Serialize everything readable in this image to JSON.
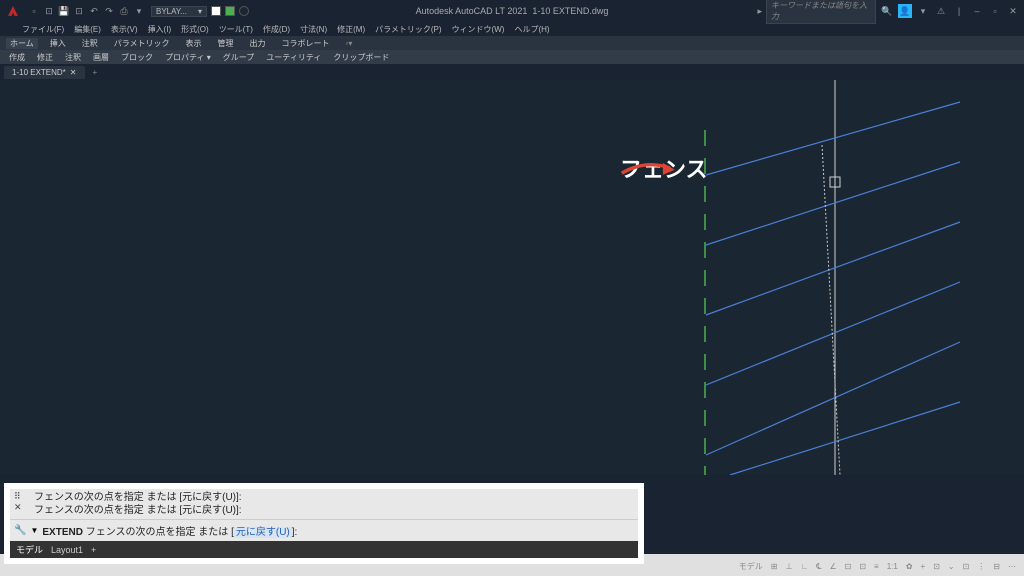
{
  "app": {
    "name": "Autodesk AutoCAD LT 2021",
    "filename": "1-10 EXTEND.dwg",
    "search_placeholder": "キーワードまたは語句を入力",
    "layer_name": "BYLAY..."
  },
  "menus": [
    "ファイル(F)",
    "編集(E)",
    "表示(V)",
    "挿入(I)",
    "形式(O)",
    "ツール(T)",
    "作成(D)",
    "寸法(N)",
    "修正(M)",
    "パラメトリック(P)",
    "ウィンドウ(W)",
    "ヘルプ(H)"
  ],
  "ribbon_tabs": [
    "ホーム",
    "挿入",
    "注釈",
    "パラメトリック",
    "表示",
    "管理",
    "出力",
    "コラボレート"
  ],
  "ribbon_panels": [
    "作成",
    "修正",
    "注釈",
    "画層",
    "ブロック",
    "プロパティ ▾",
    "グループ",
    "ユーティリティ",
    "クリップボード"
  ],
  "file_tab": {
    "name": "1-10 EXTEND*"
  },
  "annotation_label": "フェンス",
  "command": {
    "history1": "フェンスの次の点を指定 または [元に戻す(U)]:",
    "history2": "フェンスの次の点を指定 または [元に戻す(U)]:",
    "active_cmd": "EXTEND",
    "prompt_head": "フェンスの次の点を指定 または [",
    "prompt_opt": "元に戻す(U)",
    "prompt_tail": "]:"
  },
  "layout_tabs": [
    "モデル",
    "Layout1",
    "+"
  ],
  "status_items": [
    "モデル",
    "⊞",
    "⊥",
    "∟",
    "℄",
    "∠",
    "⊡",
    "⊡",
    "≡",
    "1:1",
    "✿",
    "+",
    "⊡",
    "⌄",
    "⊡",
    "⋮",
    "⊟",
    "⋯"
  ]
}
